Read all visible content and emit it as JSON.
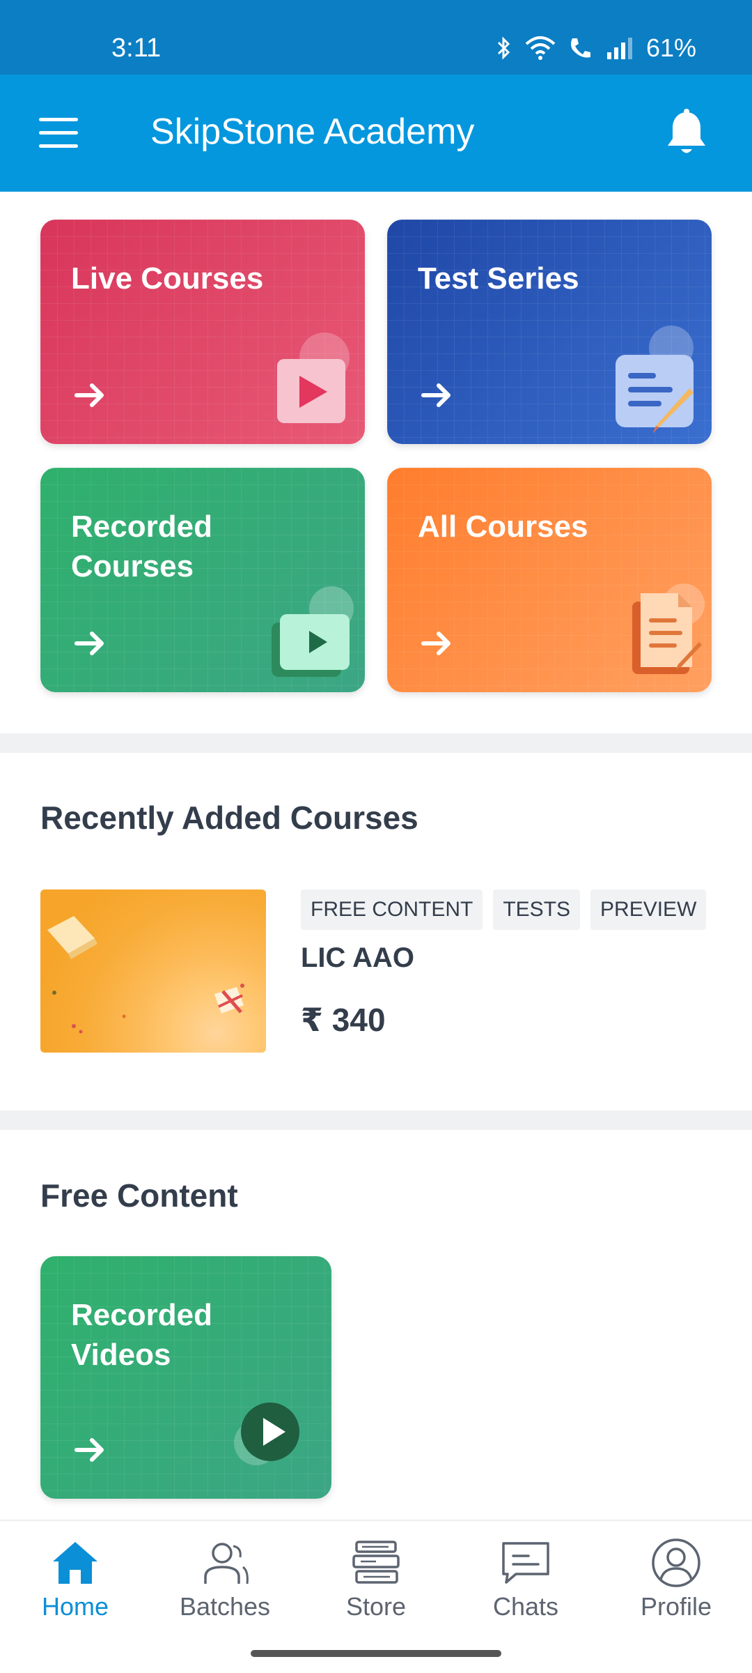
{
  "status_bar": {
    "time": "3:11",
    "battery": "61%"
  },
  "app_bar": {
    "title": "SkipStone Academy"
  },
  "tiles": [
    {
      "label": "Live Courses",
      "color": "#d8355a"
    },
    {
      "label": "Test Series",
      "color": "#1f47a6"
    },
    {
      "label": "Recorded Courses",
      "color": "#2fb06c"
    },
    {
      "label": "All Courses",
      "color": "#ff7d2d"
    }
  ],
  "recent": {
    "title": "Recently Added Courses",
    "course": {
      "chips": [
        "FREE CONTENT",
        "TESTS",
        "PREVIEW"
      ],
      "name": "LIC AAO",
      "price": "₹ 340"
    }
  },
  "free_content": {
    "title": "Free Content",
    "tile_label": "Recorded Videos"
  },
  "bottom_nav": {
    "items": [
      {
        "label": "Home",
        "icon": "home-icon",
        "active": true
      },
      {
        "label": "Batches",
        "icon": "batches-icon",
        "active": false
      },
      {
        "label": "Store",
        "icon": "store-icon",
        "active": false
      },
      {
        "label": "Chats",
        "icon": "chats-icon",
        "active": false
      },
      {
        "label": "Profile",
        "icon": "profile-icon",
        "active": false
      }
    ],
    "active_color": "#0b8fd6"
  }
}
